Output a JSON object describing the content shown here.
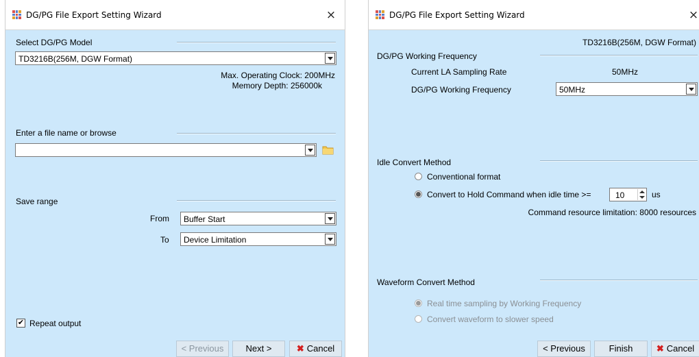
{
  "left": {
    "title": "DG/PG File Export Setting Wizard",
    "close_glyph": "×",
    "select_model_label": "Select DG/PG Model",
    "model_value": "TD3216B(256M,  DGW Format)",
    "max_clock": "Max. Operating Clock: 200MHz",
    "memory_depth": "Memory Depth: 256000k",
    "filename_label": "Enter a file name or browse",
    "filename_value": "",
    "save_range_label": "Save range",
    "from_label": "From",
    "from_value": "Buffer Start",
    "to_label": "To",
    "to_value": "Device Limitation",
    "repeat_label": "Repeat output",
    "repeat_checked": true,
    "check_glyph": "✔",
    "prev_label": "< Previous",
    "next_label": "Next >",
    "cancel_label": "Cancel",
    "cancel_glyph": "✖"
  },
  "right": {
    "title": "DG/PG File Export Setting Wizard",
    "close_glyph": "×",
    "model_value": "TD3216B(256M,  DGW Format)",
    "working_freq_header": "DG/PG Working Frequency",
    "sampling_rate_label": "Current LA Sampling Rate",
    "sampling_rate_value": "50MHz",
    "working_freq_label": "DG/PG Working Frequency",
    "working_freq_value": "50MHz",
    "idle_header": "Idle Convert Method",
    "conventional_label": "Conventional format",
    "hold_label": "Convert to Hold Command when idle time >=",
    "idle_value": "10",
    "idle_unit": "us",
    "resource_note": "Command resource limitation: 8000 resources",
    "waveform_header": "Waveform Convert Method",
    "realtime_label": "Real time sampling by Working Frequency",
    "slower_label": "Convert waveform to slower speed",
    "prev_label": "< Previous",
    "finish_label": "Finish",
    "cancel_label": "Cancel",
    "cancel_glyph": "✖"
  },
  "icons": {
    "app": "dgpg-app-icon",
    "folder": "folder-icon",
    "close": "close-icon"
  },
  "colors": {
    "window_bg": "#cde8fb",
    "cancel_x": "#d32020"
  }
}
